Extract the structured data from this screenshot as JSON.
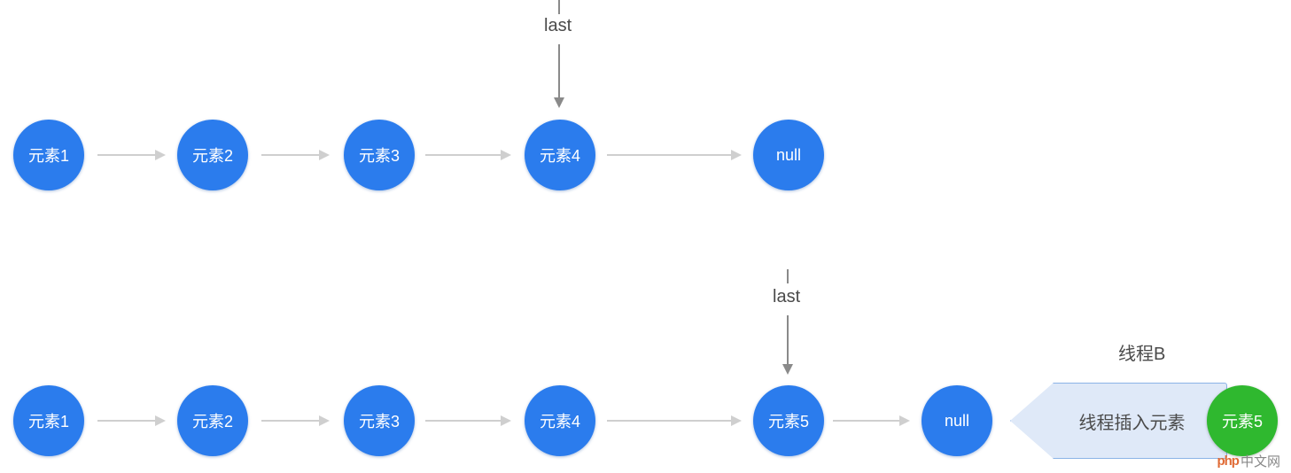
{
  "row1": {
    "pointer_label": "last",
    "nodes": [
      "元素1",
      "元素2",
      "元素3",
      "元素4",
      "null"
    ]
  },
  "row2": {
    "pointer_label": "last",
    "nodes": [
      "元素1",
      "元素2",
      "元素3",
      "元素4",
      "元素5",
      "null"
    ]
  },
  "thread_b": {
    "label": "线程B",
    "action": "线程插入元素",
    "node": "元素5"
  },
  "watermark": {
    "prefix": "php",
    "text": "中文网"
  },
  "colors": {
    "node": "#2b7ced",
    "node_green": "#2fb82f",
    "arrow": "#cfcfcf",
    "pointer": "#8a8a8a"
  }
}
